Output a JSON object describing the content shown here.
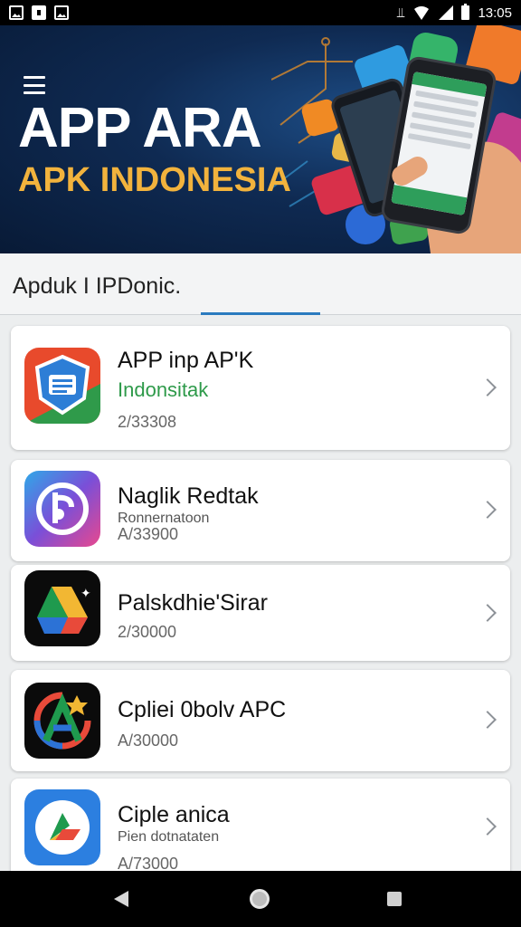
{
  "status_bar": {
    "time": "13:05",
    "icons": [
      "gallery-icon",
      "notification-icon",
      "image-icon",
      "vibrate-icon",
      "wifi-icon",
      "signal-icon",
      "battery-icon"
    ]
  },
  "banner": {
    "title": "APP ARA",
    "subtitle": "APK INDONESIA",
    "colors": {
      "background": "#0f2a52",
      "title": "#ffffff",
      "subtitle": "#f2b33d"
    }
  },
  "tabs": {
    "label": "Apduk I IPDonic."
  },
  "apps": [
    {
      "name": "APP inp AP'K",
      "category": "Indonsitak",
      "count": "2/33308",
      "icon": "shield-document-icon"
    },
    {
      "name": "Naglik Redtak",
      "note": "Ronnernatoon",
      "count": "A/33900",
      "icon": "p-letter-icon"
    },
    {
      "name": "Palskdhie'Sirar",
      "count": "2/30000",
      "icon": "drive-triangle-icon"
    },
    {
      "name": "Cpliei 0bolv APC",
      "count": "A/30000",
      "icon": "a-logo-icon"
    },
    {
      "name": "Ciple anica",
      "note": "Pien dotnataten",
      "count": "A/73000",
      "icon": "pinwheel-icon"
    }
  ],
  "nav_bar": {
    "buttons": [
      "back-icon",
      "home-icon",
      "recents-icon"
    ]
  }
}
